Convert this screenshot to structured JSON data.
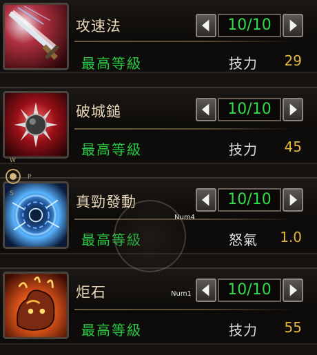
{
  "skills": [
    {
      "name": "攻速法",
      "level": "10/10",
      "max_label": "最高等級",
      "stat_label": "技力",
      "stat_value": "29",
      "icon": "sword-icon"
    },
    {
      "name": "破城鎚",
      "level": "10/10",
      "max_label": "最高等級",
      "stat_label": "技力",
      "stat_value": "45",
      "icon": "spiked-mace-icon"
    },
    {
      "name": "真勁發動",
      "level": "10/10",
      "max_label": "最高等級",
      "stat_label": "怒氣",
      "stat_value": "1.0",
      "icon": "energy-burst-icon"
    },
    {
      "name": "炬石",
      "level": "10/10",
      "max_label": "最高等級",
      "stat_label": "技力",
      "stat_value": "55",
      "icon": "flaming-rock-icon"
    }
  ],
  "hints": {
    "num4": "Num4",
    "num1": "Num1"
  },
  "compass": {
    "w": "W",
    "p": "P",
    "s": "S"
  },
  "colors": {
    "level_text": "#33d94a",
    "max_level_text": "#2bc944",
    "stat_value_text": "#e2b63a",
    "name_text": "#e8d6b8"
  }
}
